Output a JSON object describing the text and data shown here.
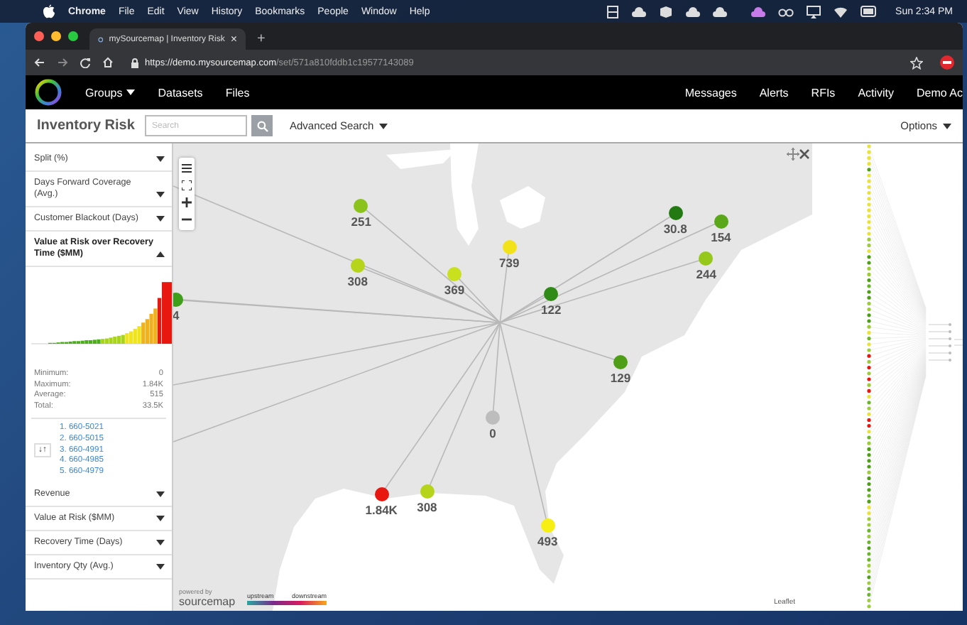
{
  "menu_bar": {
    "app": "Chrome",
    "items": [
      "File",
      "Edit",
      "View",
      "History",
      "Bookmarks",
      "People",
      "Window",
      "Help"
    ],
    "clock": "Sun 2:34 PM"
  },
  "browser": {
    "tab": {
      "title": "mySourcemap | Inventory Risk",
      "close": "×"
    },
    "new_tab": "+",
    "url_host": "https://demo.mysourcemap.com",
    "url_path": "/set/571a810fddb1c19577143089"
  },
  "nav": {
    "left": [
      {
        "label": "Groups",
        "dropdown": true
      },
      {
        "label": "Datasets",
        "dropdown": false
      },
      {
        "label": "Files",
        "dropdown": false
      }
    ],
    "right": [
      "Messages",
      "Alerts",
      "RFIs",
      "Activity",
      "Demo Ac"
    ]
  },
  "toolbar": {
    "title": "Inventory Risk",
    "search": {
      "placeholder": "Search"
    },
    "advanced": "Advanced Search",
    "options": "Options"
  },
  "sidebar": {
    "filters": [
      {
        "label": "Split (%)",
        "expanded": false
      },
      {
        "label": "Days Forward Coverage (Avg.)",
        "expanded": false
      },
      {
        "label": "Customer Blackout (Days)",
        "expanded": false
      },
      {
        "label": "Value at Risk over Recovery Time ($MM)",
        "expanded": true,
        "stats": [
          {
            "name": "Minimum:",
            "value": "0"
          },
          {
            "name": "Maximum:",
            "value": "1.84K"
          },
          {
            "name": "Average:",
            "value": "515"
          },
          {
            "name": "Total:",
            "value": "33.5K"
          }
        ],
        "sort_button": "↓↑",
        "ranking": [
          "1. 660-5021",
          "2. 660-5015",
          "3. 660-4991",
          "4. 660-4985",
          "5. 660-4979"
        ]
      },
      {
        "label": "Revenue",
        "expanded": false
      },
      {
        "label": "Value at Risk ($MM)",
        "expanded": false
      },
      {
        "label": "Recovery Time (Days)",
        "expanded": false
      },
      {
        "label": "Inventory Qty (Avg.)",
        "expanded": false
      }
    ]
  },
  "map": {
    "markers": [
      {
        "label": "4",
        "color": "#3f9e1a"
      },
      {
        "label": "251",
        "color": "#8cc21c"
      },
      {
        "label": "308",
        "color": "#b5d41a"
      },
      {
        "label": "369",
        "color": "#c9e01e"
      },
      {
        "label": "739",
        "color": "#f2e21a"
      },
      {
        "label": "122",
        "color": "#2f8a16"
      },
      {
        "label": "30.8",
        "color": "#237a12"
      },
      {
        "label": "154",
        "color": "#5aa81a"
      },
      {
        "label": "244",
        "color": "#96c81c"
      },
      {
        "label": "129",
        "color": "#4e9e18"
      },
      {
        "label": "0",
        "color": "#bdbdbd"
      },
      {
        "label": "1.84K",
        "color": "#e8170f"
      },
      {
        "label": "308",
        "color": "#b5d41a"
      },
      {
        "label": "493",
        "color": "#f7ef12"
      }
    ],
    "powered_by": "powered by",
    "brand": "sourcemap",
    "legend": [
      "upstream",
      "downstream"
    ],
    "attribution": "Leaflet"
  }
}
